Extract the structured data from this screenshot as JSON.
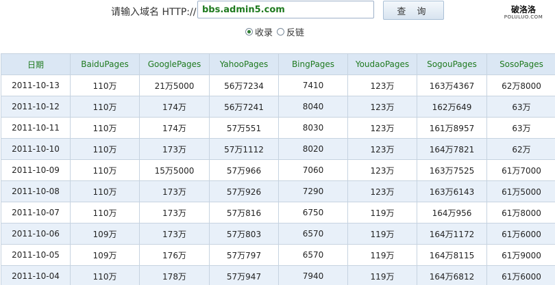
{
  "search": {
    "label": "请输入域名 HTTP://",
    "value": "bbs.admin5.com",
    "button_label": "查 询"
  },
  "logo": {
    "main": "破洛洛",
    "sub": "POLULUO.COM"
  },
  "radios": [
    {
      "label": "收录",
      "checked": true
    },
    {
      "label": "反链",
      "checked": false
    }
  ],
  "table": {
    "headers": [
      "日期",
      "BaiduPages",
      "GooglePages",
      "YahooPages",
      "BingPages",
      "YoudaoPages",
      "SogouPages",
      "SosoPages"
    ],
    "rows": [
      [
        "2011-10-13",
        "110万",
        "21万5000",
        "56万7234",
        "7410",
        "123万",
        "163万4367",
        "62万8000"
      ],
      [
        "2011-10-12",
        "110万",
        "174万",
        "56万7241",
        "8040",
        "123万",
        "162万649",
        "63万"
      ],
      [
        "2011-10-11",
        "110万",
        "174万",
        "57万551",
        "8030",
        "123万",
        "161万8957",
        "63万"
      ],
      [
        "2011-10-10",
        "110万",
        "173万",
        "57万1112",
        "8020",
        "123万",
        "164万7821",
        "62万"
      ],
      [
        "2011-10-09",
        "110万",
        "15万5000",
        "57万966",
        "7060",
        "123万",
        "163万7525",
        "61万7000"
      ],
      [
        "2011-10-08",
        "110万",
        "173万",
        "57万926",
        "7290",
        "123万",
        "163万6143",
        "61万5000"
      ],
      [
        "2011-10-07",
        "110万",
        "173万",
        "57万816",
        "6750",
        "119万",
        "164万956",
        "61万8000"
      ],
      [
        "2011-10-06",
        "109万",
        "173万",
        "57万803",
        "6570",
        "119万",
        "164万1172",
        "61万6000"
      ],
      [
        "2011-10-05",
        "109万",
        "176万",
        "57万797",
        "6570",
        "119万",
        "164万8115",
        "61万9000"
      ],
      [
        "2011-10-04",
        "110万",
        "178万",
        "57万947",
        "7940",
        "119万",
        "164万6812",
        "61万6000"
      ]
    ]
  }
}
